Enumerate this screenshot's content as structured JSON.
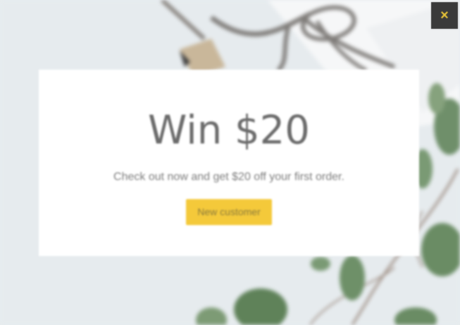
{
  "popup": {
    "close_label": "×",
    "headline": "Win $20",
    "subtext": "Check out now and get $20 off your first order.",
    "cta_label": "New customer"
  },
  "icons": {
    "close": "close-icon"
  },
  "colors": {
    "accent": "#f4c93a",
    "close_bg": "#3a3a3a",
    "close_glyph": "#e8c437",
    "card": "#ffffff",
    "background": "#e7ecef"
  }
}
